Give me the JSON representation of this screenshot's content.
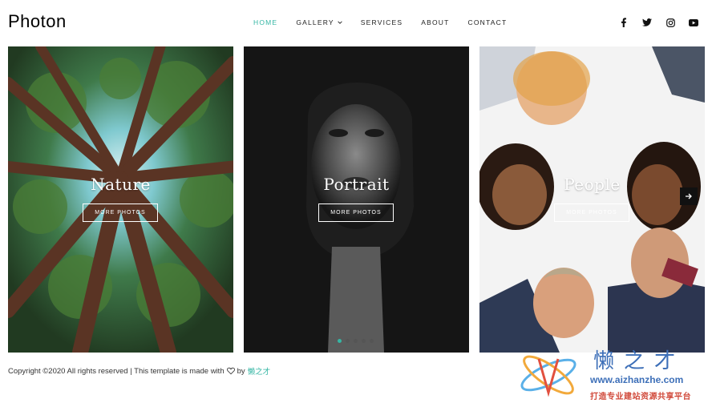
{
  "header": {
    "brand": "Photon",
    "nav": [
      {
        "label": "HOME",
        "active": true
      },
      {
        "label": "GALLERY",
        "dropdown": true
      },
      {
        "label": "SERVICES"
      },
      {
        "label": "ABOUT"
      },
      {
        "label": "CONTACT"
      }
    ],
    "social_icons": [
      "facebook-icon",
      "twitter-icon",
      "instagram-icon",
      "youtube-icon"
    ]
  },
  "slider": {
    "slides": [
      {
        "title": "Nature",
        "button": "MORE PHOTOS",
        "image": "forest-canopy-photo"
      },
      {
        "title": "Portrait",
        "button": "MORE PHOTOS",
        "image": "woman-portrait-photo"
      },
      {
        "title": "People",
        "button": "MORE PHOTOS",
        "image": "group-faces-photo"
      }
    ],
    "active_dot": 0,
    "dot_count": 5
  },
  "footer": {
    "text": "Copyright ©2020 All rights reserved | This template is made with",
    "by": "by",
    "link": "懒之才"
  },
  "watermark": {
    "cn": "懒之才",
    "url": "www.aizhanzhe.com",
    "tagline": "打造专业建站资源共享平台"
  },
  "colors": {
    "accent": "#35b6a4",
    "text": "#222222"
  }
}
